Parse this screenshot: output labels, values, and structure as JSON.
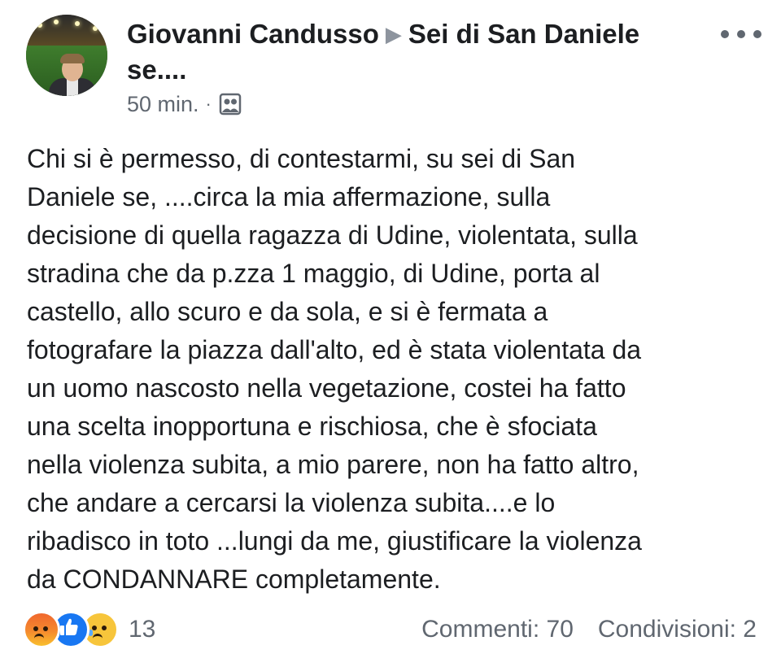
{
  "post": {
    "author": "Giovanni Candusso",
    "group_line1": "Sei di San Daniele",
    "group_line2": "se....",
    "time": "50 min.",
    "separator": "·",
    "body": "Chi si è permesso, di contestarmi, su sei di San\nDaniele se, ....circa la mia affermazione, sulla\ndecisione di quella ragazza di Udine, violentata, sulla\nstradina che da p.zza 1 maggio, di Udine, porta al\ncastello, allo scuro e da sola, e si è fermata a\nfotografare la piazza dall'alto, ed è stata violentata da\nun uomo nascosto nella vegetazione, costei ha fatto\nuna scelta inopportuna e rischiosa, che è sfociata\nnella violenza subita, a mio parere, non ha fatto altro,\nche andare a cercarsi la violenza subita....e lo\nribadisco in toto ...lungi da me, giustificare la violenza\nda CONDANNARE completamente."
  },
  "footer": {
    "reactions": [
      "angry-icon",
      "like-icon",
      "sad-icon"
    ],
    "reaction_count": "13",
    "comments": "Commenti: 70",
    "shares": "Condivisioni: 2"
  },
  "colors": {
    "text": "#1c1e21",
    "secondary": "#606770",
    "like_blue": "#1877f2",
    "angry_orange": "#f0672d",
    "sad_yellow": "#f7c53b"
  }
}
